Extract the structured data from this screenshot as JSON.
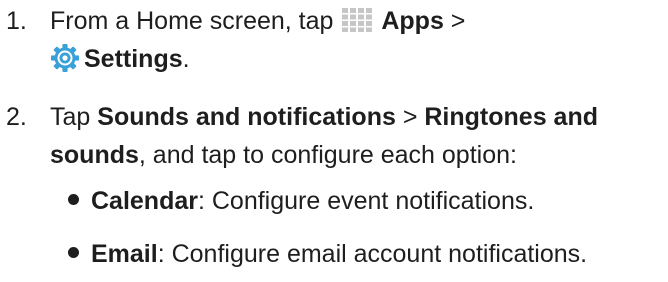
{
  "steps": [
    {
      "number": "1.",
      "line1_prefix": "From a Home screen, tap ",
      "apps_label": "Apps",
      "separator": " >",
      "settings_label": "Settings",
      "period": "."
    },
    {
      "number": "2.",
      "tap": "Tap ",
      "sounds_label": "Sounds and notifications",
      "gt": " > ",
      "ringtones_label_1": "Ringtones and",
      "ringtones_label_2": "sounds",
      "line2_rest": ", and tap to configure each option:"
    }
  ],
  "options": [
    {
      "name": "Calendar",
      "desc": ": Configure event notifications."
    },
    {
      "name": "Email",
      "desc": ": Configure email account notifications."
    }
  ],
  "icons": {
    "apps": "apps-grid-icon",
    "settings": "settings-gear-icon"
  },
  "colors": {
    "text": "#1e1e1e",
    "apps_icon": "#c6c6c6",
    "settings_outer": "#3aa0d8",
    "settings_inner": "#ffffff"
  }
}
